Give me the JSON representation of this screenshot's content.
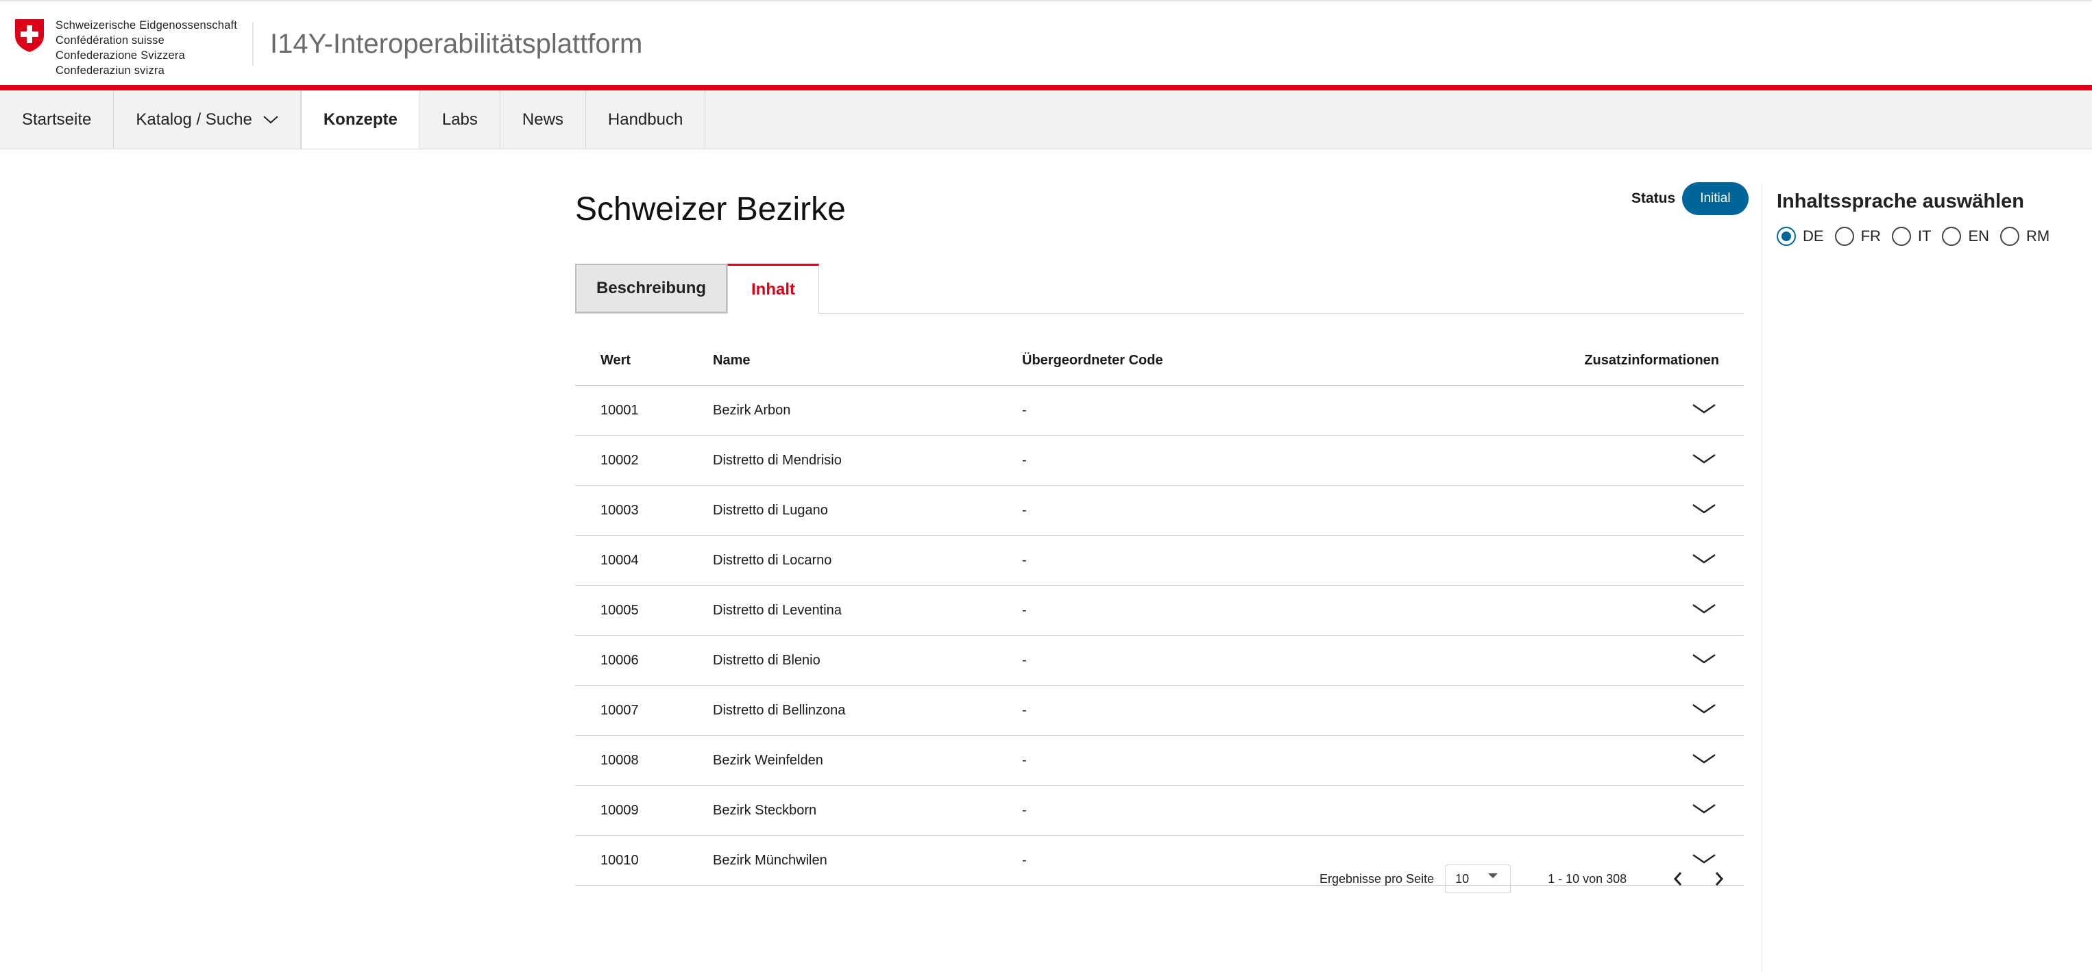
{
  "header": {
    "confederation_lines": [
      "Schweizerische Eidgenossenschaft",
      "Confédération suisse",
      "Confederazione Svizzera",
      "Confederaziun svizra"
    ],
    "app_title": "I14Y-Interoperabilitätsplattform"
  },
  "nav": {
    "items": [
      {
        "label": "Startseite"
      },
      {
        "label": "Katalog / Suche"
      },
      {
        "label": "Konzepte"
      },
      {
        "label": "Labs"
      },
      {
        "label": "News"
      },
      {
        "label": "Handbuch"
      }
    ],
    "active": "Konzepte"
  },
  "page": {
    "title": "Schweizer Bezirke",
    "status_label": "Status",
    "status_value": "Initial"
  },
  "tabs": {
    "beschreibung": "Beschreibung",
    "inhalt": "Inhalt",
    "active": "Inhalt"
  },
  "table": {
    "headers": {
      "wert": "Wert",
      "name": "Name",
      "parent": "Übergeordneter Code",
      "extra": "Zusatzinformationen"
    },
    "rows": [
      {
        "wert": "10001",
        "name": "Bezirk Arbon",
        "parent": "-"
      },
      {
        "wert": "10002",
        "name": "Distretto di Mendrisio",
        "parent": "-"
      },
      {
        "wert": "10003",
        "name": "Distretto di Lugano",
        "parent": "-"
      },
      {
        "wert": "10004",
        "name": "Distretto di Locarno",
        "parent": "-"
      },
      {
        "wert": "10005",
        "name": "Distretto di Leventina",
        "parent": "-"
      },
      {
        "wert": "10006",
        "name": "Distretto di Blenio",
        "parent": "-"
      },
      {
        "wert": "10007",
        "name": "Distretto di Bellinzona",
        "parent": "-"
      },
      {
        "wert": "10008",
        "name": "Bezirk Weinfelden",
        "parent": "-"
      },
      {
        "wert": "10009",
        "name": "Bezirk Steckborn",
        "parent": "-"
      },
      {
        "wert": "10010",
        "name": "Bezirk Münchwilen",
        "parent": "-"
      }
    ]
  },
  "pagination": {
    "per_page_label": "Ergebnisse pro Seite",
    "per_page_value": "10",
    "range_text": "1 - 10 von 308"
  },
  "language_panel": {
    "title": "Inhaltssprache auswählen",
    "options": [
      {
        "label": "DE",
        "checked": true
      },
      {
        "label": "FR",
        "checked": false
      },
      {
        "label": "IT",
        "checked": false
      },
      {
        "label": "EN",
        "checked": false
      },
      {
        "label": "RM",
        "checked": false
      }
    ]
  },
  "colors": {
    "accent_red": "#dc0018",
    "status_blue": "#006699"
  },
  "icons": {
    "crest": "swiss-crest-icon",
    "nav_dropdown": "chevron-down-icon",
    "row_expand": "chevron-down-icon",
    "pager_prev": "chevron-left-icon",
    "pager_next": "chevron-right-icon"
  }
}
